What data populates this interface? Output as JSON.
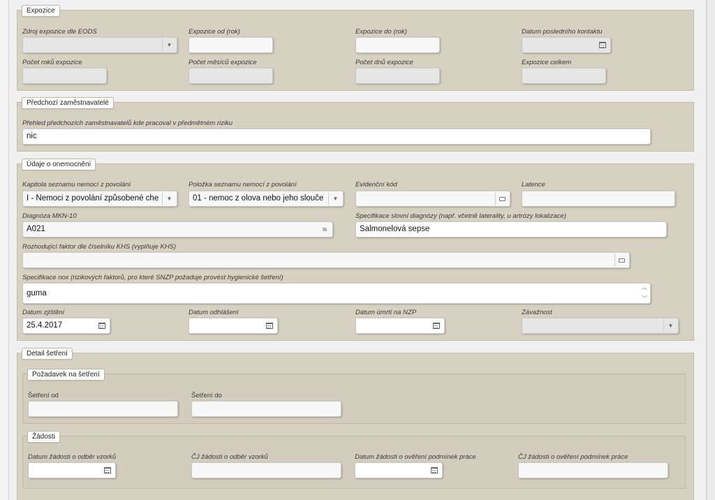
{
  "expozice": {
    "legend": "Expozice",
    "zdroj_label": "Zdroj expozice dle EODS",
    "zdroj_value": "",
    "od_label": "Expozice od (rok)",
    "od_value": "",
    "do_label": "Expozice do (rok)",
    "do_value": "",
    "kontakt_label": "Datum posledního kontaktu",
    "kontakt_value": "",
    "roku_label": "Počet roků expozice",
    "mesicu_label": "Počet měsíců expozice",
    "dnu_label": "Počet dnů expozice",
    "celkem_label": "Expozice celkem"
  },
  "predchozi": {
    "legend": "Předchozí zaměstnavatelé",
    "prehled_label": "Přehled předchozích zaměstnavatelů kde pracoval v předmětném riziku",
    "prehled_value": "nic"
  },
  "onemocneni": {
    "legend": "Údaje o onemocnění",
    "kapitola_label": "Kapitola seznamu nemocí z povolání",
    "kapitola_value": "I - Nemoci z povolání způsobené che",
    "polozka_label": "Položka seznamu nemocí z povolání",
    "polozka_value": "01 - nemoc z olova nebo jeho slouče",
    "kod_label": "Evidenční kód",
    "kod_value": "",
    "latence_label": "Latence",
    "latence_value": "",
    "mkn_label": "Diagnóza MKN-10",
    "mkn_value": "A021",
    "spec_label": "Specifikace slovní diagnózy (např. včetně laterality, u artrózy lokalizace)",
    "spec_value": "Salmonelová sepse",
    "faktor_label": "Rozhodující faktor dle číselníku KHS (vyplňuje KHS)",
    "faktor_value": "",
    "nox_label": "Specifikace nox (rizikových faktorů, pro které SNZP požaduje provést hygienické šetření)",
    "nox_value": "guma",
    "zjisteni_label": "Datum zjištění",
    "zjisteni_value": "25.4.2017",
    "odhlaseni_label": "Datum odhlášení",
    "odhlaseni_value": "",
    "umrti_label": "Datum úmrtí na NZP",
    "umrti_value": "",
    "zavaznost_label": "Závažnost",
    "zavaznost_value": ""
  },
  "detail": {
    "legend": "Detail šetření",
    "pozadavek": {
      "legend": "Požadavek na šetření",
      "od_label": "Šetření od",
      "od_value": "",
      "do_label": "Šetření do",
      "do_value": ""
    },
    "zadosti": {
      "legend": "Žádosti",
      "odber_datum_label": "Datum žádosti o odběr vzorků",
      "odber_cj_label": "ČJ žádosti o odběr vzorků",
      "overeni_datum_label": "Datum žádosti o ověření podmínek práce",
      "overeni_cj_label": "ČJ žádosti o ověření podmínek práce"
    }
  },
  "icons": {
    "dropdown": "chevron-down-icon",
    "calendar": "calendar-icon",
    "lookup": "lookup-icon",
    "link": "link-icon",
    "spinner": "spinner-arrows-icon"
  }
}
